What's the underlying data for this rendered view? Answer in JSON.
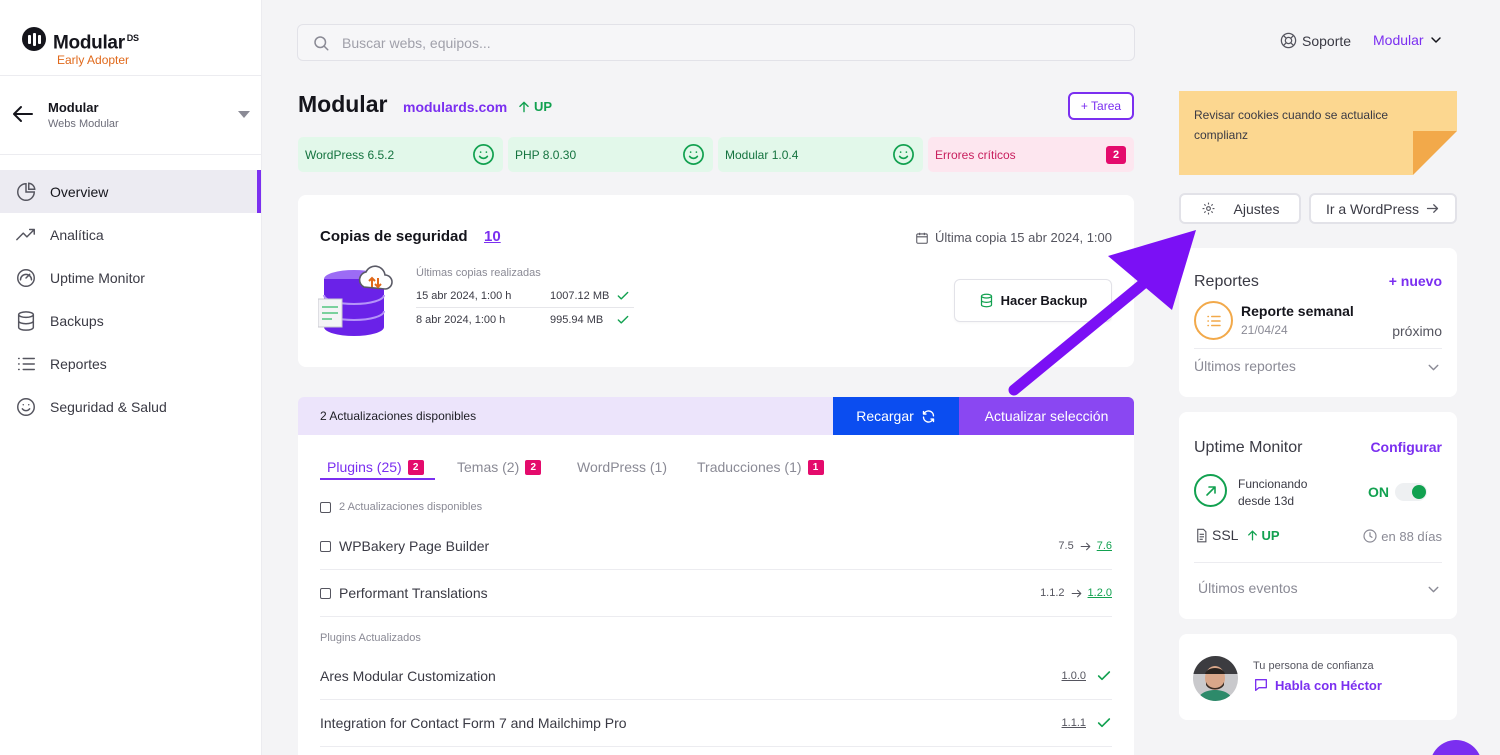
{
  "brand": {
    "name": "Modular",
    "sup": "DS",
    "tagline": "Early Adopter"
  },
  "team": {
    "name": "Modular",
    "subtitle": "Webs Modular"
  },
  "nav": [
    {
      "label": "Overview",
      "icon": "pie-chart-icon",
      "active": true
    },
    {
      "label": "Analítica",
      "icon": "trend-up-icon"
    },
    {
      "label": "Uptime Monitor",
      "icon": "gauge-icon"
    },
    {
      "label": "Backups",
      "icon": "database-icon"
    },
    {
      "label": "Reportes",
      "icon": "list-icon"
    },
    {
      "label": "Seguridad & Salud",
      "icon": "smile-icon"
    }
  ],
  "search": {
    "placeholder": "Buscar webs, equipos..."
  },
  "header": {
    "support": "Soporte",
    "user": "Modular"
  },
  "site": {
    "title": "Modular",
    "domain": "modulards.com",
    "status": "UP",
    "task_button": "+ Tarea"
  },
  "health": [
    {
      "label": "WordPress 6.5.2",
      "state": "ok"
    },
    {
      "label": "PHP 8.0.30",
      "state": "ok"
    },
    {
      "label": "Modular 1.0.4",
      "state": "ok"
    },
    {
      "label": "Errores críticos",
      "state": "error",
      "count": "2"
    }
  ],
  "backups": {
    "title": "Copias de seguridad",
    "count": "10",
    "last_copy": "Última copia 15 abr 2024, 1:00",
    "recent_title": "Últimas copias realizadas",
    "rows": [
      {
        "date": "15 abr 2024, 1:00 h",
        "size": "1007.12 MB"
      },
      {
        "date": "8 abr 2024, 1:00 h",
        "size": "995.94 MB"
      }
    ],
    "button": "Hacer Backup"
  },
  "updates": {
    "available_label": "2 Actualizaciones disponibles",
    "reload_button": "Recargar",
    "update_button": "Actualizar selección",
    "tabs": [
      {
        "label": "Plugins (25)",
        "badge": "2",
        "active": true
      },
      {
        "label": "Temas (2)",
        "badge": "2"
      },
      {
        "label": "WordPress (1)",
        "badge": ""
      },
      {
        "label": "Traducciones (1)",
        "badge": "1"
      }
    ],
    "header_checkbox_label": "2 Actualizaciones disponibles",
    "pending": [
      {
        "name": "WPBakery Page Builder",
        "from": "7.5",
        "to": "7.6"
      },
      {
        "name": "Performant Translations",
        "from": "1.1.2",
        "to": "1.2.0"
      }
    ],
    "updated_section": "Plugins Actualizados",
    "updated": [
      {
        "name": "Ares Modular Customization",
        "version": "1.0.0"
      },
      {
        "name": "Integration for Contact Form 7 and Mailchimp Pro",
        "version": "1.1.1"
      }
    ]
  },
  "note": {
    "text": "Revisar cookies cuando se actualice complianz"
  },
  "actions": {
    "settings": "Ajustes",
    "wordpress": "Ir a WordPress"
  },
  "reports": {
    "title": "Reportes",
    "new_link": "+ nuevo",
    "item_name": "Reporte semanal",
    "item_date": "21/04/24",
    "item_status": "próximo",
    "recent_label": "Últimos reportes"
  },
  "uptime": {
    "title": "Uptime Monitor",
    "configure": "Configurar",
    "status_text": "Funcionando desde 13d",
    "state": "ON",
    "ssl_label": "SSL",
    "ssl_status": "UP",
    "ssl_expiry": "en 88 días",
    "events_label": "Últimos eventos"
  },
  "contact": {
    "label": "Tu persona de confianza",
    "link": "Habla con Héctor"
  },
  "colors": {
    "accent": "#7b2ff0",
    "primary_button": "#0b4df0",
    "success": "#12a150",
    "danger": "#e40b6c",
    "note": "#fcd790"
  }
}
